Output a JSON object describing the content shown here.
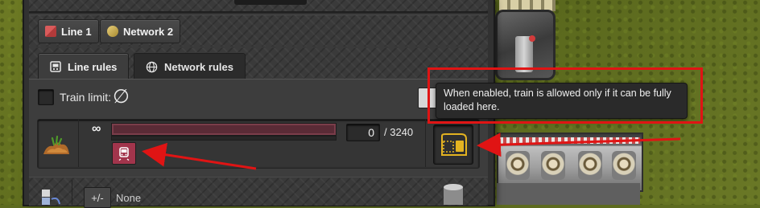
{
  "chips": {
    "line": {
      "label": "Line 1",
      "icon": "line-icon"
    },
    "network": {
      "label": "Network 2",
      "icon": "network-icon"
    }
  },
  "tabs": [
    {
      "label": "Line rules",
      "icon": "train-schedule-icon",
      "active": true
    },
    {
      "label": "Network rules",
      "icon": "globe-icon",
      "active": false
    }
  ],
  "train_limit": {
    "label": "Train limit:",
    "value_symbol": "∅",
    "checked": false
  },
  "rule": {
    "resource_icon": "ore-pile-icon",
    "infinity_symbol": "∞",
    "count_value": "0",
    "count_total": "/ 3240",
    "train_button_icon": "train-icon",
    "load_button_icon": "full-load-icon"
  },
  "next_row": {
    "label": "None",
    "button_symbol": "+/-"
  },
  "tooltip": {
    "text": "When enabled, train is allowed only if it can be fully loaded here."
  },
  "colors": {
    "highlight_red": "#e01414",
    "train_button": "#a2354c",
    "load_icon_yellow": "#e3b321"
  }
}
